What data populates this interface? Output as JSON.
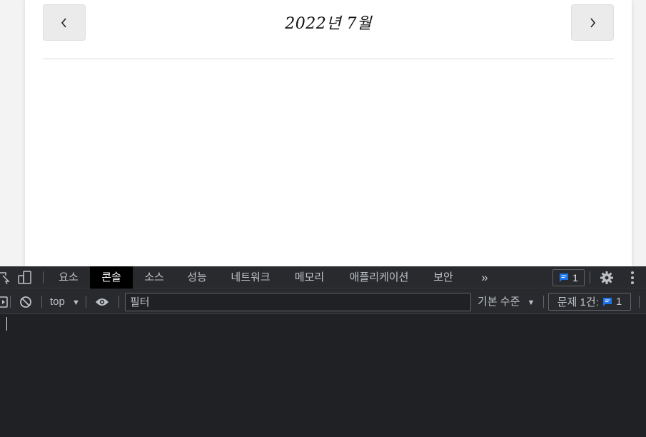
{
  "page": {
    "month_title": "2022년 7월",
    "prev_label": "‹",
    "next_label": "›"
  },
  "devtools": {
    "tabs": [
      "요소",
      "콘솔",
      "소스",
      "성능",
      "네트워크",
      "메모리",
      "애플리케이션",
      "보안"
    ],
    "active_tab": "콘솔",
    "more_tabs": "»",
    "issues_count": "1",
    "context": "top",
    "filter_placeholder": "필터",
    "levels_label": "기본 수준",
    "issues_label": "문제 1건:",
    "issues_badge_count": "1",
    "colors": {
      "accent": "#1a73e8",
      "panel_bg": "#202124",
      "toolbar_bg": "#292a2d"
    }
  }
}
